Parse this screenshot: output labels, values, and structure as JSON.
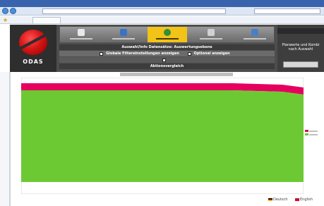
{
  "app": {
    "logo_text": "ODAS",
    "brand_red": "#d81515",
    "toolbar": {
      "items": [
        {
          "icon": "document-icon",
          "active": false
        },
        {
          "icon": "chart-icon",
          "active": false
        },
        {
          "icon": "globe-icon",
          "active": true
        },
        {
          "icon": "table-icon",
          "active": false
        },
        {
          "icon": "screen-icon",
          "active": false
        }
      ]
    },
    "bands": {
      "row1": "Auswahl/Info Datensätze: Auswertungsebene",
      "row2_options": [
        "Globale Filtereinstellungen anzeigen",
        "Optional anzeigen"
      ],
      "row3_options": [
        ""
      ],
      "row4": "Aktionsvergleich"
    },
    "right_panel": {
      "text": "Planwerte und Kombi nach Auswahl"
    }
  },
  "chart_data": {
    "type": "area",
    "note_colors": {
      "top_series": "#e5005f",
      "bottom_series": "#6cc934"
    }
  },
  "footer": {
    "languages": [
      "Deutsch",
      "English"
    ]
  }
}
